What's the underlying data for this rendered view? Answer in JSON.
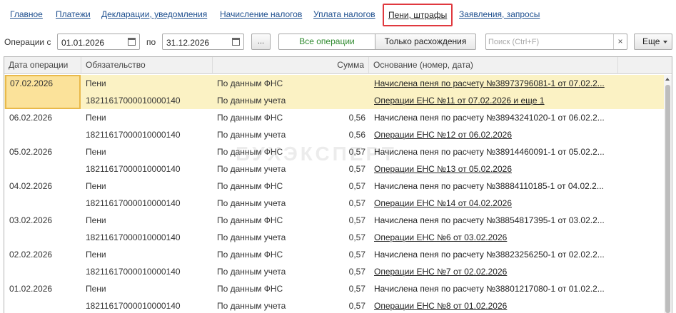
{
  "nav": {
    "tabs": [
      {
        "label": "Главное",
        "active": false
      },
      {
        "label": "Платежи",
        "active": false
      },
      {
        "label": "Декларации, уведомления",
        "active": false
      },
      {
        "label": "Начисление налогов",
        "active": false
      },
      {
        "label": "Уплата налогов",
        "active": false
      },
      {
        "label": "Пени, штрафы",
        "active": true
      },
      {
        "label": "Заявления, запросы",
        "active": false
      }
    ]
  },
  "toolbar": {
    "from_label": "Операции с",
    "from_date": "01.01.2026",
    "to_label": "по",
    "to_date": "31.12.2026",
    "dots_label": "...",
    "all_ops_label": "Все операции",
    "diff_only_label": "Только расхождения",
    "search_placeholder": "Поиск (Ctrl+F)",
    "clear_label": "×",
    "more_label": "Еще"
  },
  "table": {
    "columns": [
      "Дата операции",
      "Обязательство",
      "Сумма",
      "Основание (номер, дата)"
    ],
    "rows": [
      {
        "date": "07.02.2026",
        "obligation": "Пени",
        "kbk": "18211617000010000140",
        "source1": "По данным ФНС",
        "source2": "По данным учета",
        "sum1": "",
        "sum2": "",
        "basis1": "Начислена пеня по расчету №38973796081-1 от 07.02.2...",
        "basis2": "Операции ЕНС №11 от 07.02.2026 и еще 1",
        "basis1_underline": true
      },
      {
        "date": "06.02.2026",
        "obligation": "Пени",
        "kbk": "18211617000010000140",
        "source1": "По данным ФНС",
        "source2": "По данным учета",
        "sum1": "0,56",
        "sum2": "0,56",
        "basis1": "Начислена пеня по расчету №38943241020-1 от 06.02.2...",
        "basis2": "Операции ЕНС №12 от 06.02.2026",
        "basis1_underline": false
      },
      {
        "date": "05.02.2026",
        "obligation": "Пени",
        "kbk": "18211617000010000140",
        "source1": "По данным ФНС",
        "source2": "По данным учета",
        "sum1": "0,57",
        "sum2": "0,57",
        "basis1": "Начислена пеня по расчету №38914460091-1 от 05.02.2...",
        "basis2": "Операции ЕНС №13 от 05.02.2026",
        "basis1_underline": false
      },
      {
        "date": "04.02.2026",
        "obligation": "Пени",
        "kbk": "18211617000010000140",
        "source1": "По данным ФНС",
        "source2": "По данным учета",
        "sum1": "0,57",
        "sum2": "0,57",
        "basis1": "Начислена пеня по расчету №38884110185-1 от 04.02.2...",
        "basis2": "Операции ЕНС №14 от 04.02.2026",
        "basis1_underline": false
      },
      {
        "date": "03.02.2026",
        "obligation": "Пени",
        "kbk": "18211617000010000140",
        "source1": "По данным ФНС",
        "source2": "По данным учета",
        "sum1": "0,57",
        "sum2": "0,57",
        "basis1": "Начислена пеня по расчету №38854817395-1 от 03.02.2...",
        "basis2": "Операции ЕНС №6 от 03.02.2026",
        "basis1_underline": false
      },
      {
        "date": "02.02.2026",
        "obligation": "Пени",
        "kbk": "18211617000010000140",
        "source1": "По данным ФНС",
        "source2": "По данным учета",
        "sum1": "0,57",
        "sum2": "0,57",
        "basis1": "Начислена пеня по расчету №38823256250-1 от 02.02.2...",
        "basis2": "Операции ЕНС №7 от 02.02.2026",
        "basis1_underline": false
      },
      {
        "date": "01.02.2026",
        "obligation": "Пени",
        "kbk": "18211617000010000140",
        "source1": "По данным ФНС",
        "source2": "По данным учета",
        "sum1": "0,57",
        "sum2": "0,57",
        "basis1": "Начислена пеня по расчету №38801217080-1 от 01.02.2...",
        "basis2": "Операции ЕНС №8 от 01.02.2026",
        "basis1_underline": false
      }
    ]
  },
  "watermark": "БУХЭКСПЕРТ",
  "colors": {
    "active_border": "#e0393f",
    "selected_row": "#fbf2c4",
    "link": "#1e4f8f"
  }
}
